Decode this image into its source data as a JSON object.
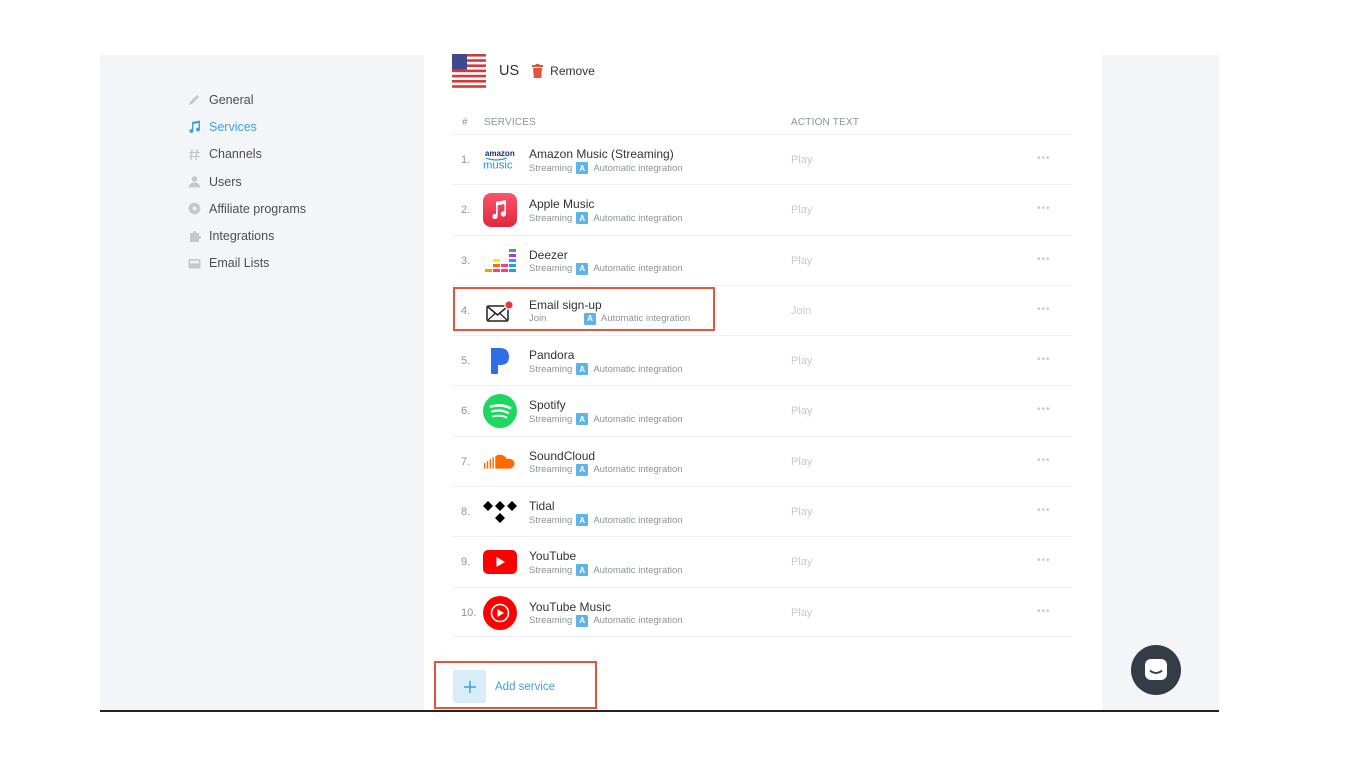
{
  "sidebar": {
    "items": [
      {
        "label": "General",
        "icon": "pencil-icon",
        "active": false
      },
      {
        "label": "Services",
        "icon": "music-note-icon",
        "active": true
      },
      {
        "label": "Channels",
        "icon": "hash-icon",
        "active": false
      },
      {
        "label": "Users",
        "icon": "user-icon",
        "active": false
      },
      {
        "label": "Affiliate programs",
        "icon": "coin-icon",
        "active": false
      },
      {
        "label": "Integrations",
        "icon": "puzzle-icon",
        "active": false
      },
      {
        "label": "Email Lists",
        "icon": "inbox-icon",
        "active": false
      }
    ]
  },
  "country": {
    "code": "US",
    "remove_label": "Remove",
    "flag_icon": "us-flag-icon"
  },
  "table": {
    "headers": {
      "num": "#",
      "services": "SERVICES",
      "action": "ACTION TEXT"
    },
    "badge": "A",
    "more": "•••",
    "rows": [
      {
        "num": "1.",
        "name": "Amazon Music (Streaming)",
        "type": "Streaming",
        "integration": "Automatic integration",
        "action": "Play",
        "logo": "amazon-music-logo-icon"
      },
      {
        "num": "2.",
        "name": "Apple Music",
        "type": "Streaming",
        "integration": "Automatic integration",
        "action": "Play",
        "logo": "apple-music-logo-icon"
      },
      {
        "num": "3.",
        "name": "Deezer",
        "type": "Streaming",
        "integration": "Automatic integration",
        "action": "Play",
        "logo": "deezer-logo-icon"
      },
      {
        "num": "4.",
        "name": "Email sign-up",
        "type": "Join",
        "integration": "Automatic integration",
        "action": "Join",
        "logo": "email-envelope-icon"
      },
      {
        "num": "5.",
        "name": "Pandora",
        "type": "Streaming",
        "integration": "Automatic integration",
        "action": "Play",
        "logo": "pandora-logo-icon"
      },
      {
        "num": "6.",
        "name": "Spotify",
        "type": "Streaming",
        "integration": "Automatic integration",
        "action": "Play",
        "logo": "spotify-logo-icon"
      },
      {
        "num": "7.",
        "name": "SoundCloud",
        "type": "Streaming",
        "integration": "Automatic integration",
        "action": "Play",
        "logo": "soundcloud-logo-icon"
      },
      {
        "num": "8.",
        "name": "Tidal",
        "type": "Streaming",
        "integration": "Automatic integration",
        "action": "Play",
        "logo": "tidal-logo-icon"
      },
      {
        "num": "9.",
        "name": "YouTube",
        "type": "Streaming",
        "integration": "Automatic integration",
        "action": "Play",
        "logo": "youtube-logo-icon"
      },
      {
        "num": "10.",
        "name": "YouTube Music",
        "type": "Streaming",
        "integration": "Automatic integration",
        "action": "Play",
        "logo": "youtube-music-logo-icon"
      }
    ]
  },
  "add_service": {
    "label": "Add service"
  },
  "logos": {
    "amazon_top": "amazon",
    "amazon_bottom": "music"
  },
  "colors": {
    "accent": "#3ea1e0",
    "highlight": "#e5533c",
    "sidebar_bg": "#f3f5f8"
  }
}
